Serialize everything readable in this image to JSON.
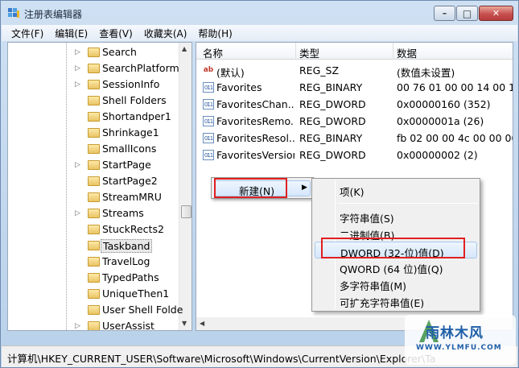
{
  "window": {
    "title": "注册表编辑器",
    "caption_min": "–",
    "caption_max": "□",
    "caption_close": "✕"
  },
  "menu": [
    {
      "label": "文件(F)"
    },
    {
      "label": "编辑(E)"
    },
    {
      "label": "查看(V)"
    },
    {
      "label": "收藏夹(A)"
    },
    {
      "label": "帮助(H)"
    }
  ],
  "tree": {
    "items": [
      {
        "label": "Search",
        "has_children": true,
        "selected": false
      },
      {
        "label": "SearchPlatform",
        "has_children": true,
        "selected": false
      },
      {
        "label": "SessionInfo",
        "has_children": true,
        "selected": false
      },
      {
        "label": "Shell Folders",
        "has_children": false,
        "selected": false
      },
      {
        "label": "Shortandper1",
        "has_children": false,
        "selected": false
      },
      {
        "label": "Shrinkage1",
        "has_children": false,
        "selected": false
      },
      {
        "label": "SmallIcons",
        "has_children": false,
        "selected": false
      },
      {
        "label": "StartPage",
        "has_children": true,
        "selected": false
      },
      {
        "label": "StartPage2",
        "has_children": false,
        "selected": false
      },
      {
        "label": "StreamMRU",
        "has_children": false,
        "selected": false
      },
      {
        "label": "Streams",
        "has_children": true,
        "selected": false
      },
      {
        "label": "StuckRects2",
        "has_children": false,
        "selected": false
      },
      {
        "label": "Taskband",
        "has_children": false,
        "selected": true
      },
      {
        "label": "TravelLog",
        "has_children": false,
        "selected": false
      },
      {
        "label": "TypedPaths",
        "has_children": false,
        "selected": false
      },
      {
        "label": "UniqueThen1",
        "has_children": false,
        "selected": false
      },
      {
        "label": "User Shell Folde",
        "has_children": false,
        "selected": false
      },
      {
        "label": "UserAssist",
        "has_children": true,
        "selected": false
      }
    ]
  },
  "values": {
    "columns": [
      "名称",
      "类型",
      "数据"
    ],
    "rows": [
      {
        "icon": "string-value-icon",
        "name": "(默认)",
        "type": "REG_SZ",
        "data": "(数值未设置)"
      },
      {
        "icon": "binary-value-icon",
        "name": "Favorites",
        "type": "REG_BINARY",
        "data": "00 76 01 00 00 14 00 1f 8"
      },
      {
        "icon": "binary-value-icon",
        "name": "FavoritesChan...",
        "type": "REG_DWORD",
        "data": "0x00000160 (352)"
      },
      {
        "icon": "binary-value-icon",
        "name": "FavoritesRemo...",
        "type": "REG_DWORD",
        "data": "0x0000001a (26)"
      },
      {
        "icon": "binary-value-icon",
        "name": "FavoritesResol...",
        "type": "REG_BINARY",
        "data": "fb 02 00 00 4c 00 00 00 0"
      },
      {
        "icon": "binary-value-icon",
        "name": "FavoritesVersion",
        "type": "REG_DWORD",
        "data": "0x00000002 (2)"
      }
    ]
  },
  "context_menu": {
    "new_label": "新建(N)",
    "submenu_arrow": "▶"
  },
  "submenu": {
    "items": [
      {
        "label": "项(K)",
        "highlighted": false
      },
      {
        "label": "字符串值(S)",
        "highlighted": false
      },
      {
        "label": "二进制值(B)",
        "highlighted": false
      },
      {
        "label": "DWORD (32-位)值(D)",
        "highlighted": true
      },
      {
        "label": "QWORD (64 位)值(Q)",
        "highlighted": false
      },
      {
        "label": "多字符串值(M)",
        "highlighted": false
      },
      {
        "label": "可扩充字符串值(E)",
        "highlighted": false
      }
    ]
  },
  "status": {
    "path": "计算机\\HKEY_CURRENT_USER\\Software\\Microsoft\\Windows\\CurrentVersion\\Explorer\\Ta"
  },
  "watermark": {
    "text": "雨林木风",
    "url": "WWW.YLMFU.COM"
  },
  "colors": {
    "highlight_border": "#e02020",
    "title_bg": "#cfe0f3",
    "close_button": "#c75050"
  }
}
